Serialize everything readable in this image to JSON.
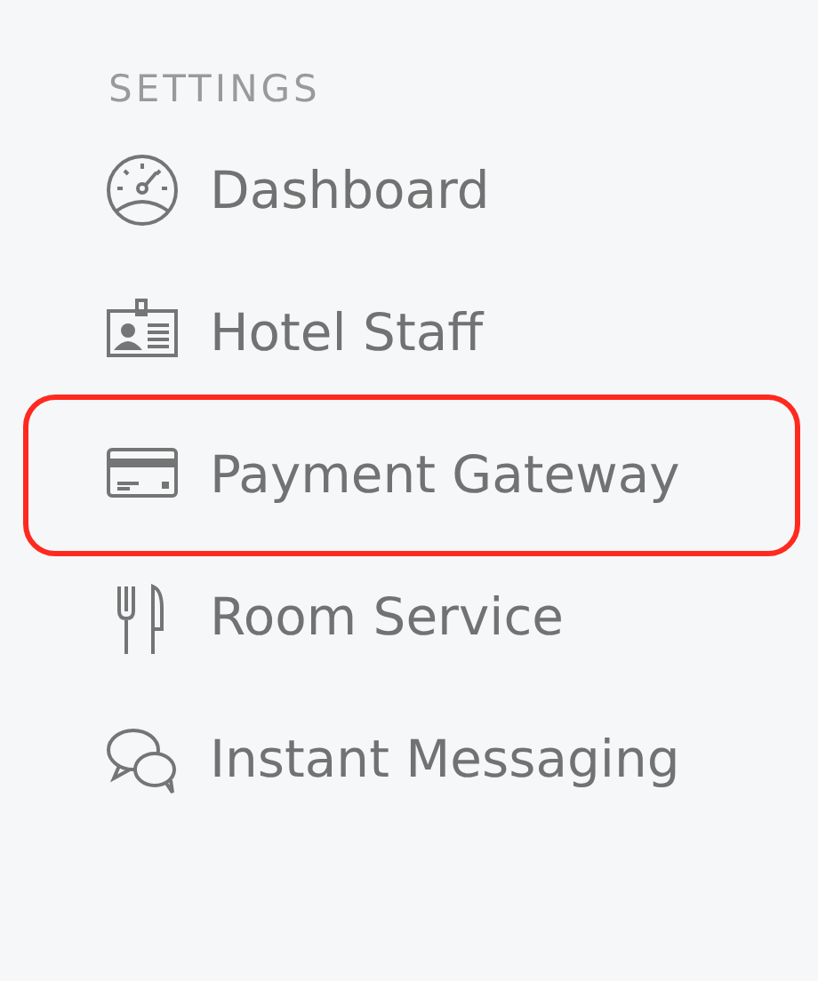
{
  "section_title": "SETTINGS",
  "items": [
    {
      "label": "Dashboard",
      "selected": false
    },
    {
      "label": "Hotel Staff",
      "selected": false
    },
    {
      "label": "Payment Gateway",
      "selected": true
    },
    {
      "label": "Room Service",
      "selected": false
    },
    {
      "label": "Instant Messaging",
      "selected": false
    }
  ]
}
